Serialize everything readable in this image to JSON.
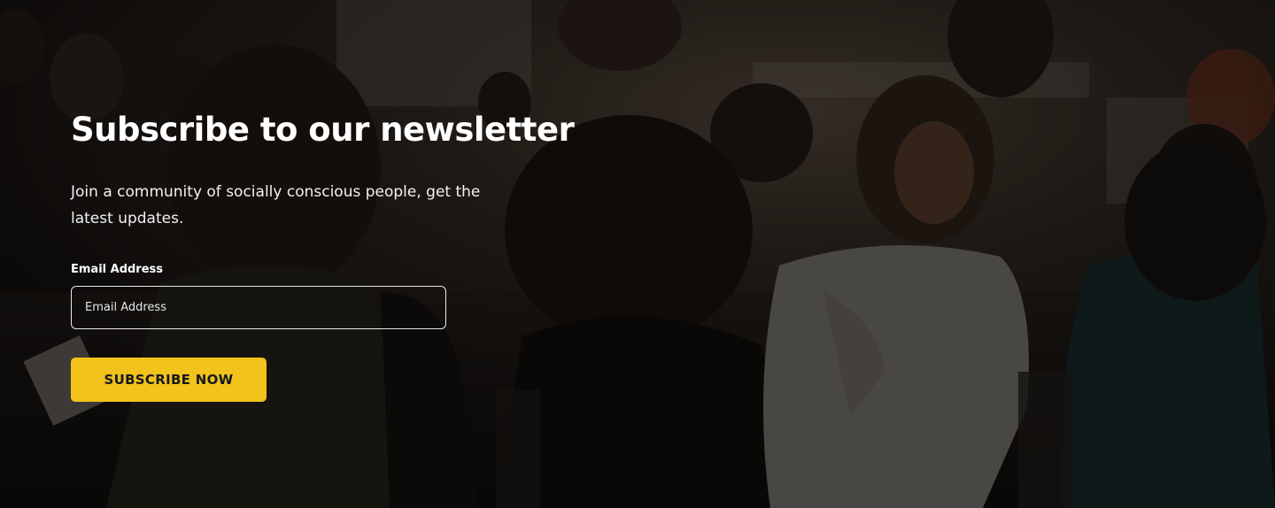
{
  "newsletter": {
    "title": "Subscribe to our newsletter",
    "description": "Join a community of socially conscious people, get the latest updates.",
    "email_label": "Email Address",
    "email_placeholder": "Email Address",
    "email_value": "",
    "subscribe_label": "SUBSCRIBE NOW"
  },
  "colors": {
    "accent": "#f1c31b",
    "button_text": "#15181f",
    "heading_text": "#ffffff",
    "overlay": "rgba(0,0,0,0.52)"
  },
  "background": {
    "image_subject": "audience-seated-at-event"
  }
}
